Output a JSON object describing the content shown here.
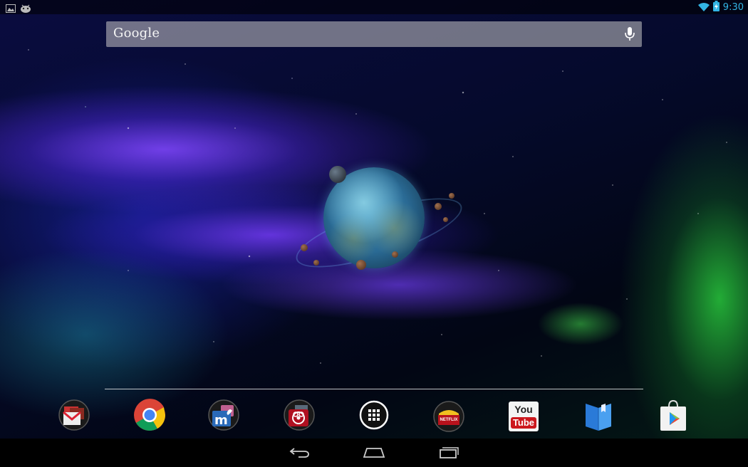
{
  "status_bar": {
    "time": "9:30",
    "left_icons": [
      "gallery-notification-icon",
      "android-notification-icon"
    ],
    "right_icons": [
      "wifi-icon",
      "battery-charging-icon"
    ]
  },
  "search": {
    "label": "Google",
    "icon": "mic-icon"
  },
  "dock": {
    "apps": [
      {
        "name": "gmail",
        "icon": "gmail-folder-icon"
      },
      {
        "name": "chrome",
        "icon": "chrome-icon"
      },
      {
        "name": "messenger",
        "icon": "messenger-folder-icon"
      },
      {
        "name": "plague",
        "icon": "plague-folder-icon"
      },
      {
        "name": "all-apps",
        "icon": "all-apps-icon"
      },
      {
        "name": "netflix",
        "icon": "netflix-folder-icon",
        "label": "NETFLIX"
      },
      {
        "name": "youtube",
        "icon": "youtube-icon",
        "label_top": "You",
        "label_bottom": "Tube"
      },
      {
        "name": "play-books",
        "icon": "play-books-icon"
      },
      {
        "name": "play-store",
        "icon": "play-store-icon"
      }
    ]
  },
  "nav_bar": {
    "buttons": [
      "back-icon",
      "home-icon",
      "recent-apps-icon"
    ]
  },
  "colors": {
    "accent": "#33b5e5",
    "youtube_red": "#cc181e",
    "chrome_red": "#db4437",
    "chrome_yellow": "#f4c20d",
    "chrome_green": "#0f9d58",
    "chrome_blue": "#4285f4"
  }
}
